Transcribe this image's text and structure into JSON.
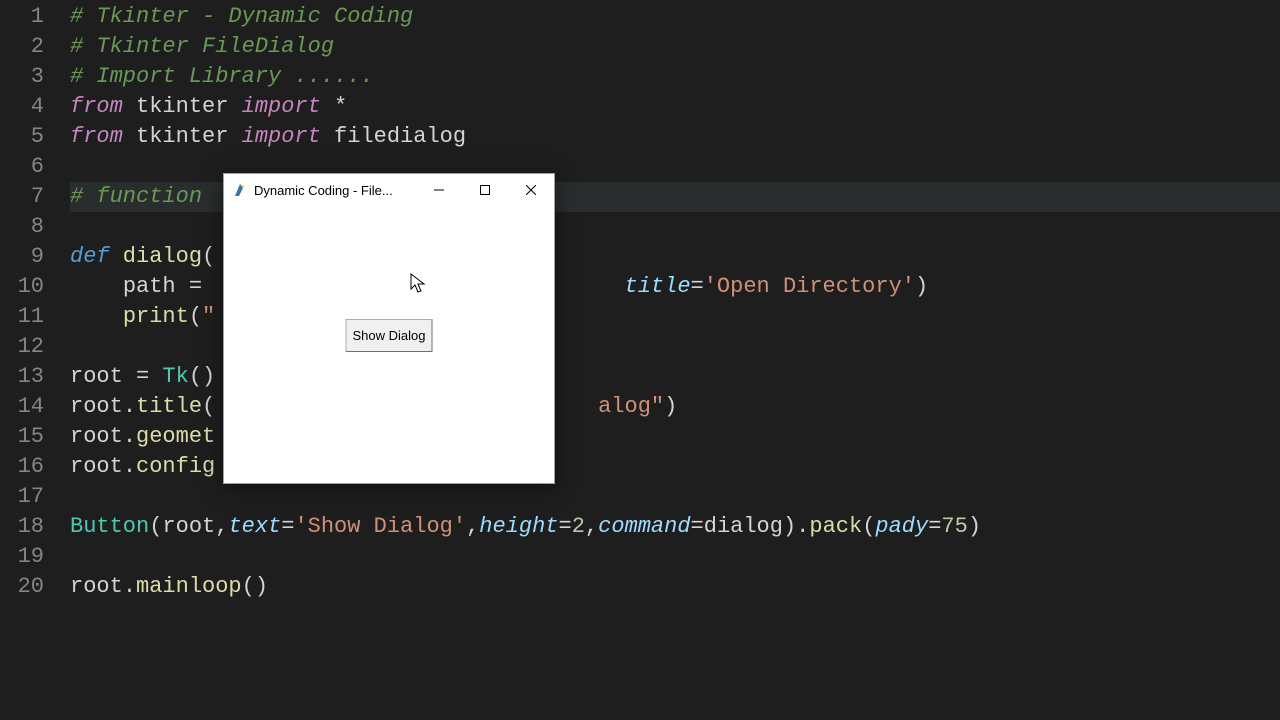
{
  "gutter": [
    "1",
    "2",
    "3",
    "4",
    "5",
    "6",
    "7",
    "8",
    "9",
    "10",
    "11",
    "12",
    "13",
    "14",
    "15",
    "16",
    "17",
    "18",
    "19",
    "20"
  ],
  "code": {
    "l1_comment": "# Tkinter - Dynamic Coding",
    "l2_comment": "# Tkinter FileDialog",
    "l3_comment": "# Import Library ......",
    "l4_from": "from",
    "l4_mod": " tkinter ",
    "l4_import": "import",
    "l4_star": " *",
    "l5_from": "from",
    "l5_mod": " tkinter ",
    "l5_import": "import",
    "l5_name": " filedialog",
    "l7_comment": "# function",
    "l9_def": "def",
    "l9_name": " dialog",
    "l9_paren": "(",
    "l10_indent": "    ",
    "l10_var": "path",
    "l10_eq": " = ",
    "l10_title_kw": "title",
    "l10_eq2": "=",
    "l10_str": "'Open Directory'",
    "l10_close": ")",
    "l11_indent": "    ",
    "l11_print": "print",
    "l11_paren": "(",
    "l11_quote": "\"",
    "l13_root": "root",
    "l13_eq": " = ",
    "l13_tk": "Tk",
    "l13_paren": "()",
    "l14_root": "root",
    "l14_dot": ".",
    "l14_title": "title",
    "l14_paren": "(",
    "l14_trail": "alog\"",
    "l14_close": ")",
    "l15_root": "root",
    "l15_dot": ".",
    "l15_geom": "geomet",
    "l16_root": "root",
    "l16_dot": ".",
    "l16_config": "config",
    "l18_btn": "Button",
    "l18_p1": "(",
    "l18_root": "root",
    "l18_c1": ",",
    "l18_text_kw": "text",
    "l18_eq1": "=",
    "l18_text_str": "'Show Dialog'",
    "l18_c2": ",",
    "l18_height_kw": "height",
    "l18_eq2": "=",
    "l18_height_num": "2",
    "l18_c3": ",",
    "l18_cmd_kw": "command",
    "l18_eq3": "=",
    "l18_cmd_val": "dialog",
    "l18_p2": ")",
    "l18_dot": ".",
    "l18_pack": "pack",
    "l18_p3": "(",
    "l18_pady_kw": "pady",
    "l18_eq4": "=",
    "l18_pady_num": "75",
    "l18_p4": ")",
    "l20_root": "root",
    "l20_dot": ".",
    "l20_main": "mainloop",
    "l20_paren": "()"
  },
  "tkwin": {
    "title": "Dynamic Coding - File...",
    "button_label": "Show Dialog"
  }
}
